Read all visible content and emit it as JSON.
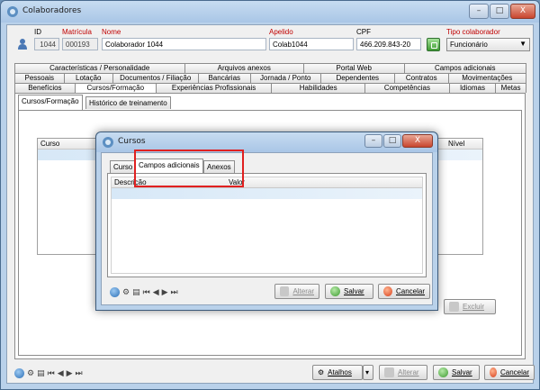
{
  "window": {
    "title": "Colaboradores",
    "controls": [
      "–",
      "□",
      "X"
    ]
  },
  "header": {
    "id_label": "ID",
    "id_value": "1044",
    "matricula_label": "Matrícula",
    "matricula_value": "000193",
    "nome_label": "Nome",
    "nome_value": "Colaborador 1044",
    "apelido_label": "Apelido",
    "apelido_value": "Colab1044",
    "cpf_label": "CPF",
    "cpf_value": "466.209.843-20",
    "tipo_label": "Tipo colaborador",
    "tipo_value": "Funcionário"
  },
  "tabs": {
    "row1": [
      "Características / Personalidade",
      "Arquivos anexos",
      "Portal Web",
      "Campos adicionais"
    ],
    "row2": [
      "Pessoais",
      "Lotação",
      "Documentos / Filiação",
      "Bancárias",
      "Jornada / Ponto",
      "Dependentes",
      "Contratos",
      "Movimentações"
    ],
    "row3": [
      "Benefícios",
      "Cursos/Formação",
      "Experiências Profissionais",
      "Habilidades",
      "Competências",
      "Idiomas",
      "Metas"
    ],
    "active": "Cursos/Formação"
  },
  "subtabs": [
    "Cursos/Formação",
    "Histórico de treinamento"
  ],
  "main_grid": {
    "columns": [
      "Curso",
      "Nível"
    ]
  },
  "main_buttons": {
    "excluir": "Excluir"
  },
  "footer": {
    "atalhos": "Atalhos",
    "alterar": "Alterar",
    "salvar": "Salvar",
    "cancelar": "Cancelar"
  },
  "dialog": {
    "title": "Cursos",
    "controls": [
      "–",
      "□",
      "X"
    ],
    "tabs": [
      "Curso",
      "Campos adicionais",
      "Anexos"
    ],
    "active_tab": "Campos adicionais",
    "grid_columns": [
      "Descrição",
      "Valor"
    ],
    "buttons": {
      "alterar": "Alterar",
      "salvar": "Salvar",
      "cancelar": "Cancelar"
    }
  },
  "colors": {
    "highlight": "#e02020",
    "title_bar": "#b9d1ea",
    "required_label": "#c00000"
  }
}
